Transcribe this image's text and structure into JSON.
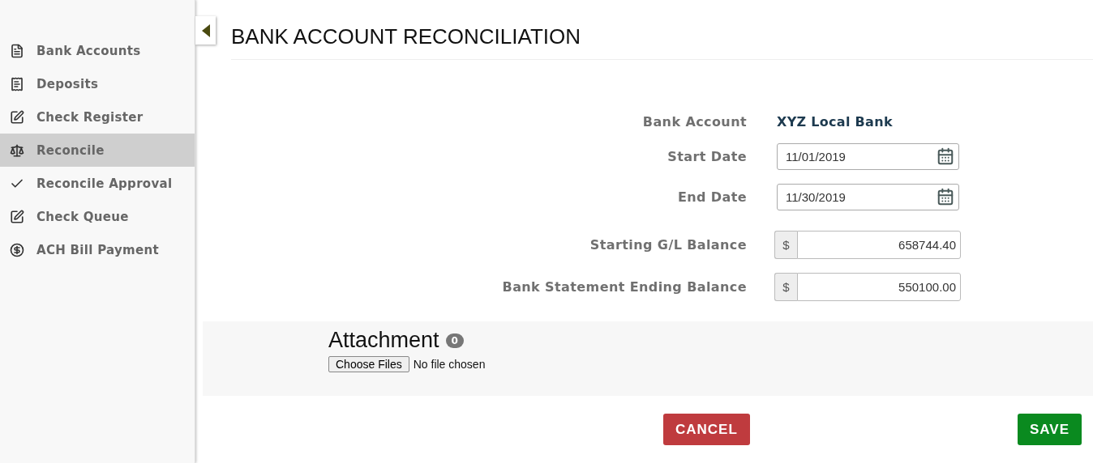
{
  "sidebar": {
    "items": [
      {
        "label": "Bank Accounts",
        "selected": false
      },
      {
        "label": "Deposits",
        "selected": false
      },
      {
        "label": "Check Register",
        "selected": false
      },
      {
        "label": "Reconcile",
        "selected": true
      },
      {
        "label": "Reconcile Approval",
        "selected": false
      },
      {
        "label": "Check Queue",
        "selected": false
      },
      {
        "label": "ACH Bill Payment",
        "selected": false
      }
    ]
  },
  "title": "BANK ACCOUNT RECONCILIATION",
  "fields": [
    {
      "kind": "text",
      "label": "Bank Account",
      "value": "XYZ Local Bank"
    },
    {
      "kind": "date",
      "label": "Start Date",
      "value": "11/01/2019"
    },
    {
      "kind": "date",
      "label": "End Date",
      "value": "11/30/2019"
    },
    {
      "kind": "currency",
      "label": "Starting G/L Balance",
      "symbol": "$",
      "value": "658744.40"
    },
    {
      "kind": "currency",
      "label": "Bank Statement Ending Balance",
      "symbol": "$",
      "value": "550100.00"
    }
  ],
  "attachment": {
    "title": "Attachment",
    "count": "0",
    "button": "Choose Files",
    "status": "No file chosen"
  },
  "buttons": [
    {
      "label": "CANCEL",
      "kind": "cancel"
    },
    {
      "label": "SAVE",
      "kind": "save"
    }
  ]
}
